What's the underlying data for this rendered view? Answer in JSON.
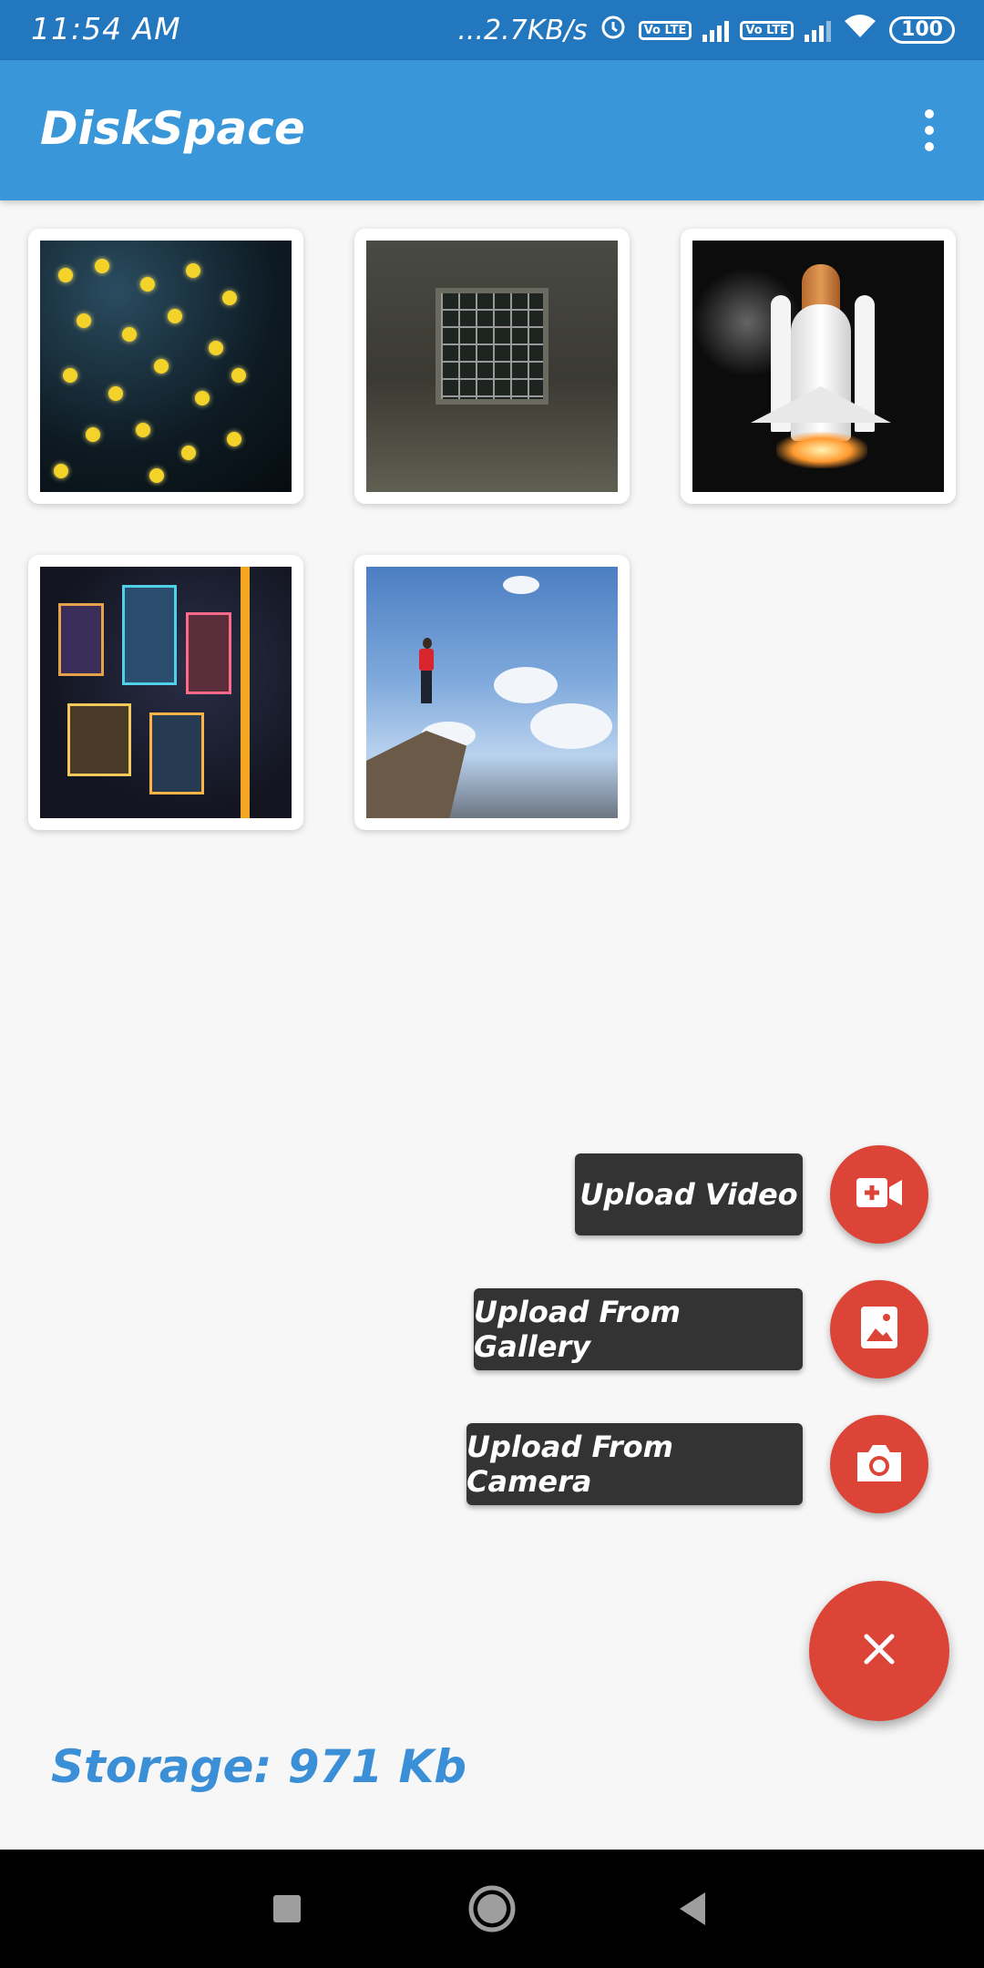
{
  "status_bar": {
    "time": "11:54 AM",
    "net_speed": "...2.7KB/s",
    "volte_1": "Vo LTE",
    "volte_2": "Vo LTE",
    "battery": "100",
    "icons": [
      "alarm-icon",
      "signal-icon",
      "wifi-icon",
      "battery-icon"
    ]
  },
  "app_bar": {
    "title": "DiskSpace",
    "menu_icon": "overflow-menu-icon"
  },
  "gallery": {
    "images": [
      {
        "subject": "yellow-bokeh-lights"
      },
      {
        "subject": "barred-window-brick-wall"
      },
      {
        "subject": "space-shuttle-launch"
      },
      {
        "subject": "city-at-night-aerial"
      },
      {
        "subject": "hiker-on-cliff"
      }
    ]
  },
  "speed_dial": {
    "actions": [
      {
        "label": "Upload Video",
        "icon": "video-add-icon"
      },
      {
        "label": "Upload From Gallery",
        "icon": "image-icon"
      },
      {
        "label": "Upload From Camera",
        "icon": "camera-icon"
      }
    ],
    "main_icon": "close-icon"
  },
  "storage": {
    "text": "Storage: 971 Kb"
  },
  "colors": {
    "status_bar": "#2277bf",
    "app_bar": "#3896d9",
    "fab": "#db4437",
    "label_bg": "#333333",
    "storage_text": "#3a8fd6"
  },
  "nav_bar": {
    "buttons": [
      "recents-icon",
      "home-icon",
      "back-icon"
    ]
  }
}
